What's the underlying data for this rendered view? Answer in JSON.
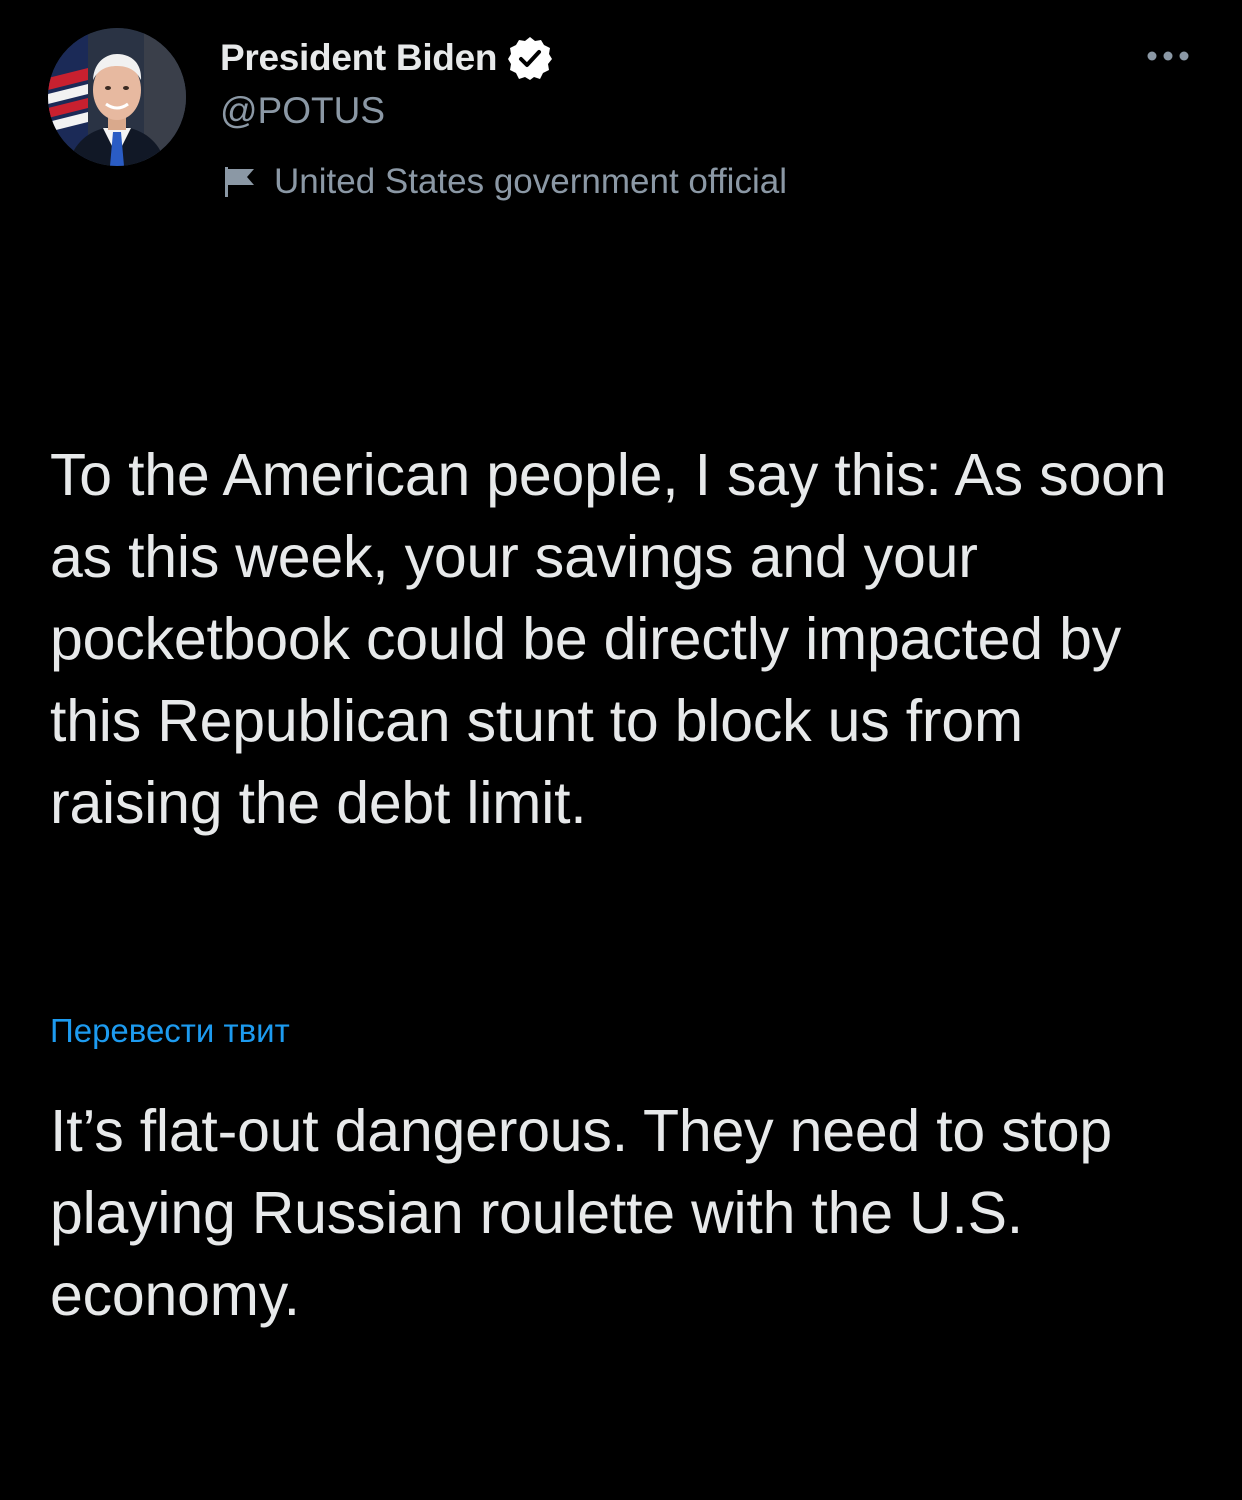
{
  "author": {
    "display_name": "President Biden",
    "handle": "@POTUS",
    "verified": true,
    "avatar_icon": "portrait-avatar",
    "affiliation_icon": "flag-icon",
    "affiliation_label": "United States government official"
  },
  "tweet": {
    "paragraphs": [
      "To the American people, I say this: As soon as this week, your savings and your pocketbook could be directly impacted by this Republican stunt to block us from raising the debt limit.",
      "It’s flat-out dangerous. They need to stop playing Russian roulette with the U.S. economy."
    ],
    "translate_label": "Перевести твит"
  },
  "icons": {
    "more": "more-horizontal-icon",
    "verified": "verified-badge-icon"
  },
  "colors": {
    "background": "#000000",
    "text_primary": "#e7e9ea",
    "text_secondary": "#8b98a5",
    "link": "#1d9bf0",
    "verified_badge": "#ffffff"
  }
}
